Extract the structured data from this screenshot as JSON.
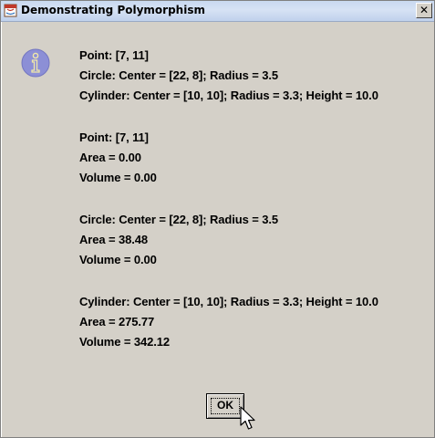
{
  "window": {
    "title": "Demonstrating Polymorphism",
    "close_glyph": "✕"
  },
  "icons": {
    "title": "java-window-icon",
    "message": "information-icon",
    "info_letter": "i"
  },
  "message": {
    "lines": [
      "Point: [7, 11]",
      "Circle: Center = [22, 8]; Radius = 3.5",
      "Cylinder: Center = [10, 10]; Radius = 3.3; Height = 10.0",
      "Point: [7, 11]",
      "Area = 0.00",
      "Volume = 0.00",
      "Circle: Center = [22, 8]; Radius = 3.5",
      "Area = 38.48",
      "Volume = 0.00",
      "Cylinder: Center = [10, 10]; Radius = 3.3; Height = 10.0",
      "Area = 275.77",
      "Volume = 342.12"
    ]
  },
  "buttons": {
    "ok_label": "OK"
  },
  "colors": {
    "dialog_background": "#d4d0c8",
    "title_bar": "#c9d9f0",
    "info_icon": "#8c8fd6"
  }
}
